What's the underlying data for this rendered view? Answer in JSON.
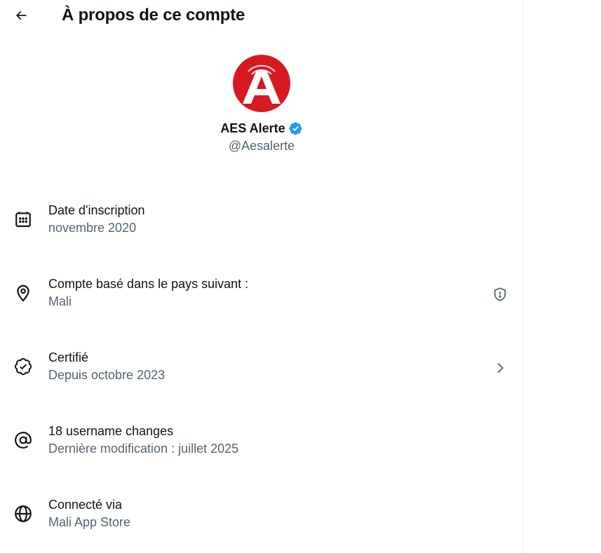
{
  "header": {
    "title": "À propos de ce compte",
    "back_icon": "arrow-left-icon"
  },
  "profile": {
    "display_name": "AES Alerte",
    "handle": "@Aesalerte",
    "verified": true,
    "avatar_letter": "A",
    "avatar_color": "#d71920",
    "verified_color": "#1d9bf0"
  },
  "rows": [
    {
      "icon": "calendar-icon",
      "title": "Date d'inscription",
      "subtitle": "novembre 2020"
    },
    {
      "icon": "location-pin-icon",
      "title": "Compte basé dans le pays suivant :",
      "subtitle": "Mali",
      "trailing_icon": "shield-alert-icon"
    },
    {
      "icon": "verified-badge-icon",
      "title": "Certifié",
      "subtitle": "Depuis octobre 2023",
      "trailing_icon": "chevron-right-icon"
    },
    {
      "icon": "at-sign-icon",
      "title": "18 username changes",
      "subtitle": "Dernière modification : juillet 2025"
    },
    {
      "icon": "globe-icon",
      "title": "Connecté via",
      "subtitle": "Mali App Store"
    }
  ]
}
